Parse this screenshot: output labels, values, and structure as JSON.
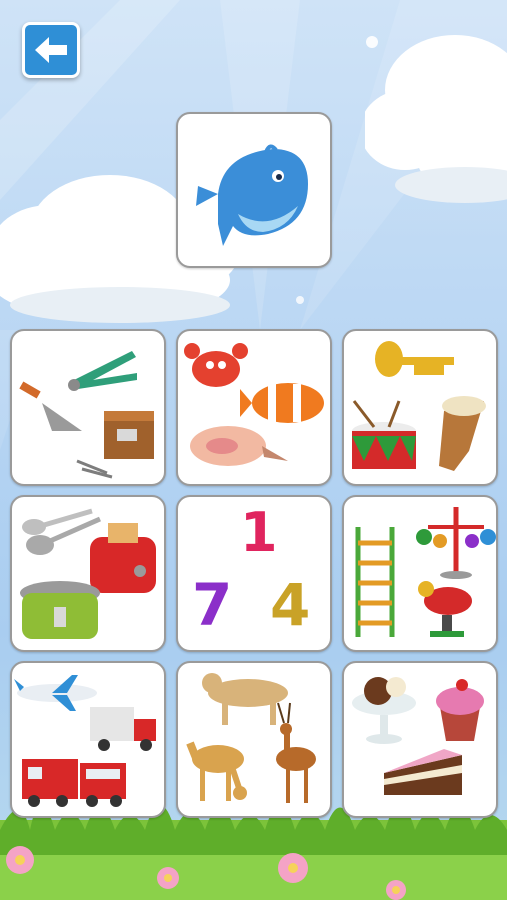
{
  "header": {
    "back_icon": "arrow-left-icon"
  },
  "target": {
    "icon": "whale-icon"
  },
  "cards": [
    {
      "id": "tools",
      "icons": [
        "pliers-icon",
        "trowel-icon",
        "toolbox-icon",
        "nails-icon"
      ]
    },
    {
      "id": "sea-animals",
      "icons": [
        "crab-icon",
        "clownfish-icon",
        "seashell-icon"
      ]
    },
    {
      "id": "instruments",
      "icons": [
        "trumpet-icon",
        "drum-icon",
        "djembe-icon"
      ]
    },
    {
      "id": "kitchen",
      "icons": [
        "spoons-icon",
        "toaster-icon",
        "rice-cooker-icon"
      ]
    },
    {
      "id": "numbers",
      "digits": [
        "1",
        "7",
        "4"
      ]
    },
    {
      "id": "playground",
      "icons": [
        "ladder-icon",
        "merry-go-round-icon",
        "spring-rider-icon"
      ]
    },
    {
      "id": "vehicles",
      "icons": [
        "airplane-icon",
        "truck-icon",
        "train-icon"
      ]
    },
    {
      "id": "wild-animals",
      "icons": [
        "lioness-icon",
        "giraffe-icon",
        "antelope-icon"
      ]
    },
    {
      "id": "desserts",
      "icons": [
        "ice-cream-sundae-icon",
        "cupcake-icon",
        "cake-slice-icon"
      ]
    }
  ],
  "colors": {
    "button_blue": "#2f8fd6",
    "digit_1": "#e0245e",
    "digit_7": "#8b2fc9",
    "digit_4": "#c9a227"
  }
}
